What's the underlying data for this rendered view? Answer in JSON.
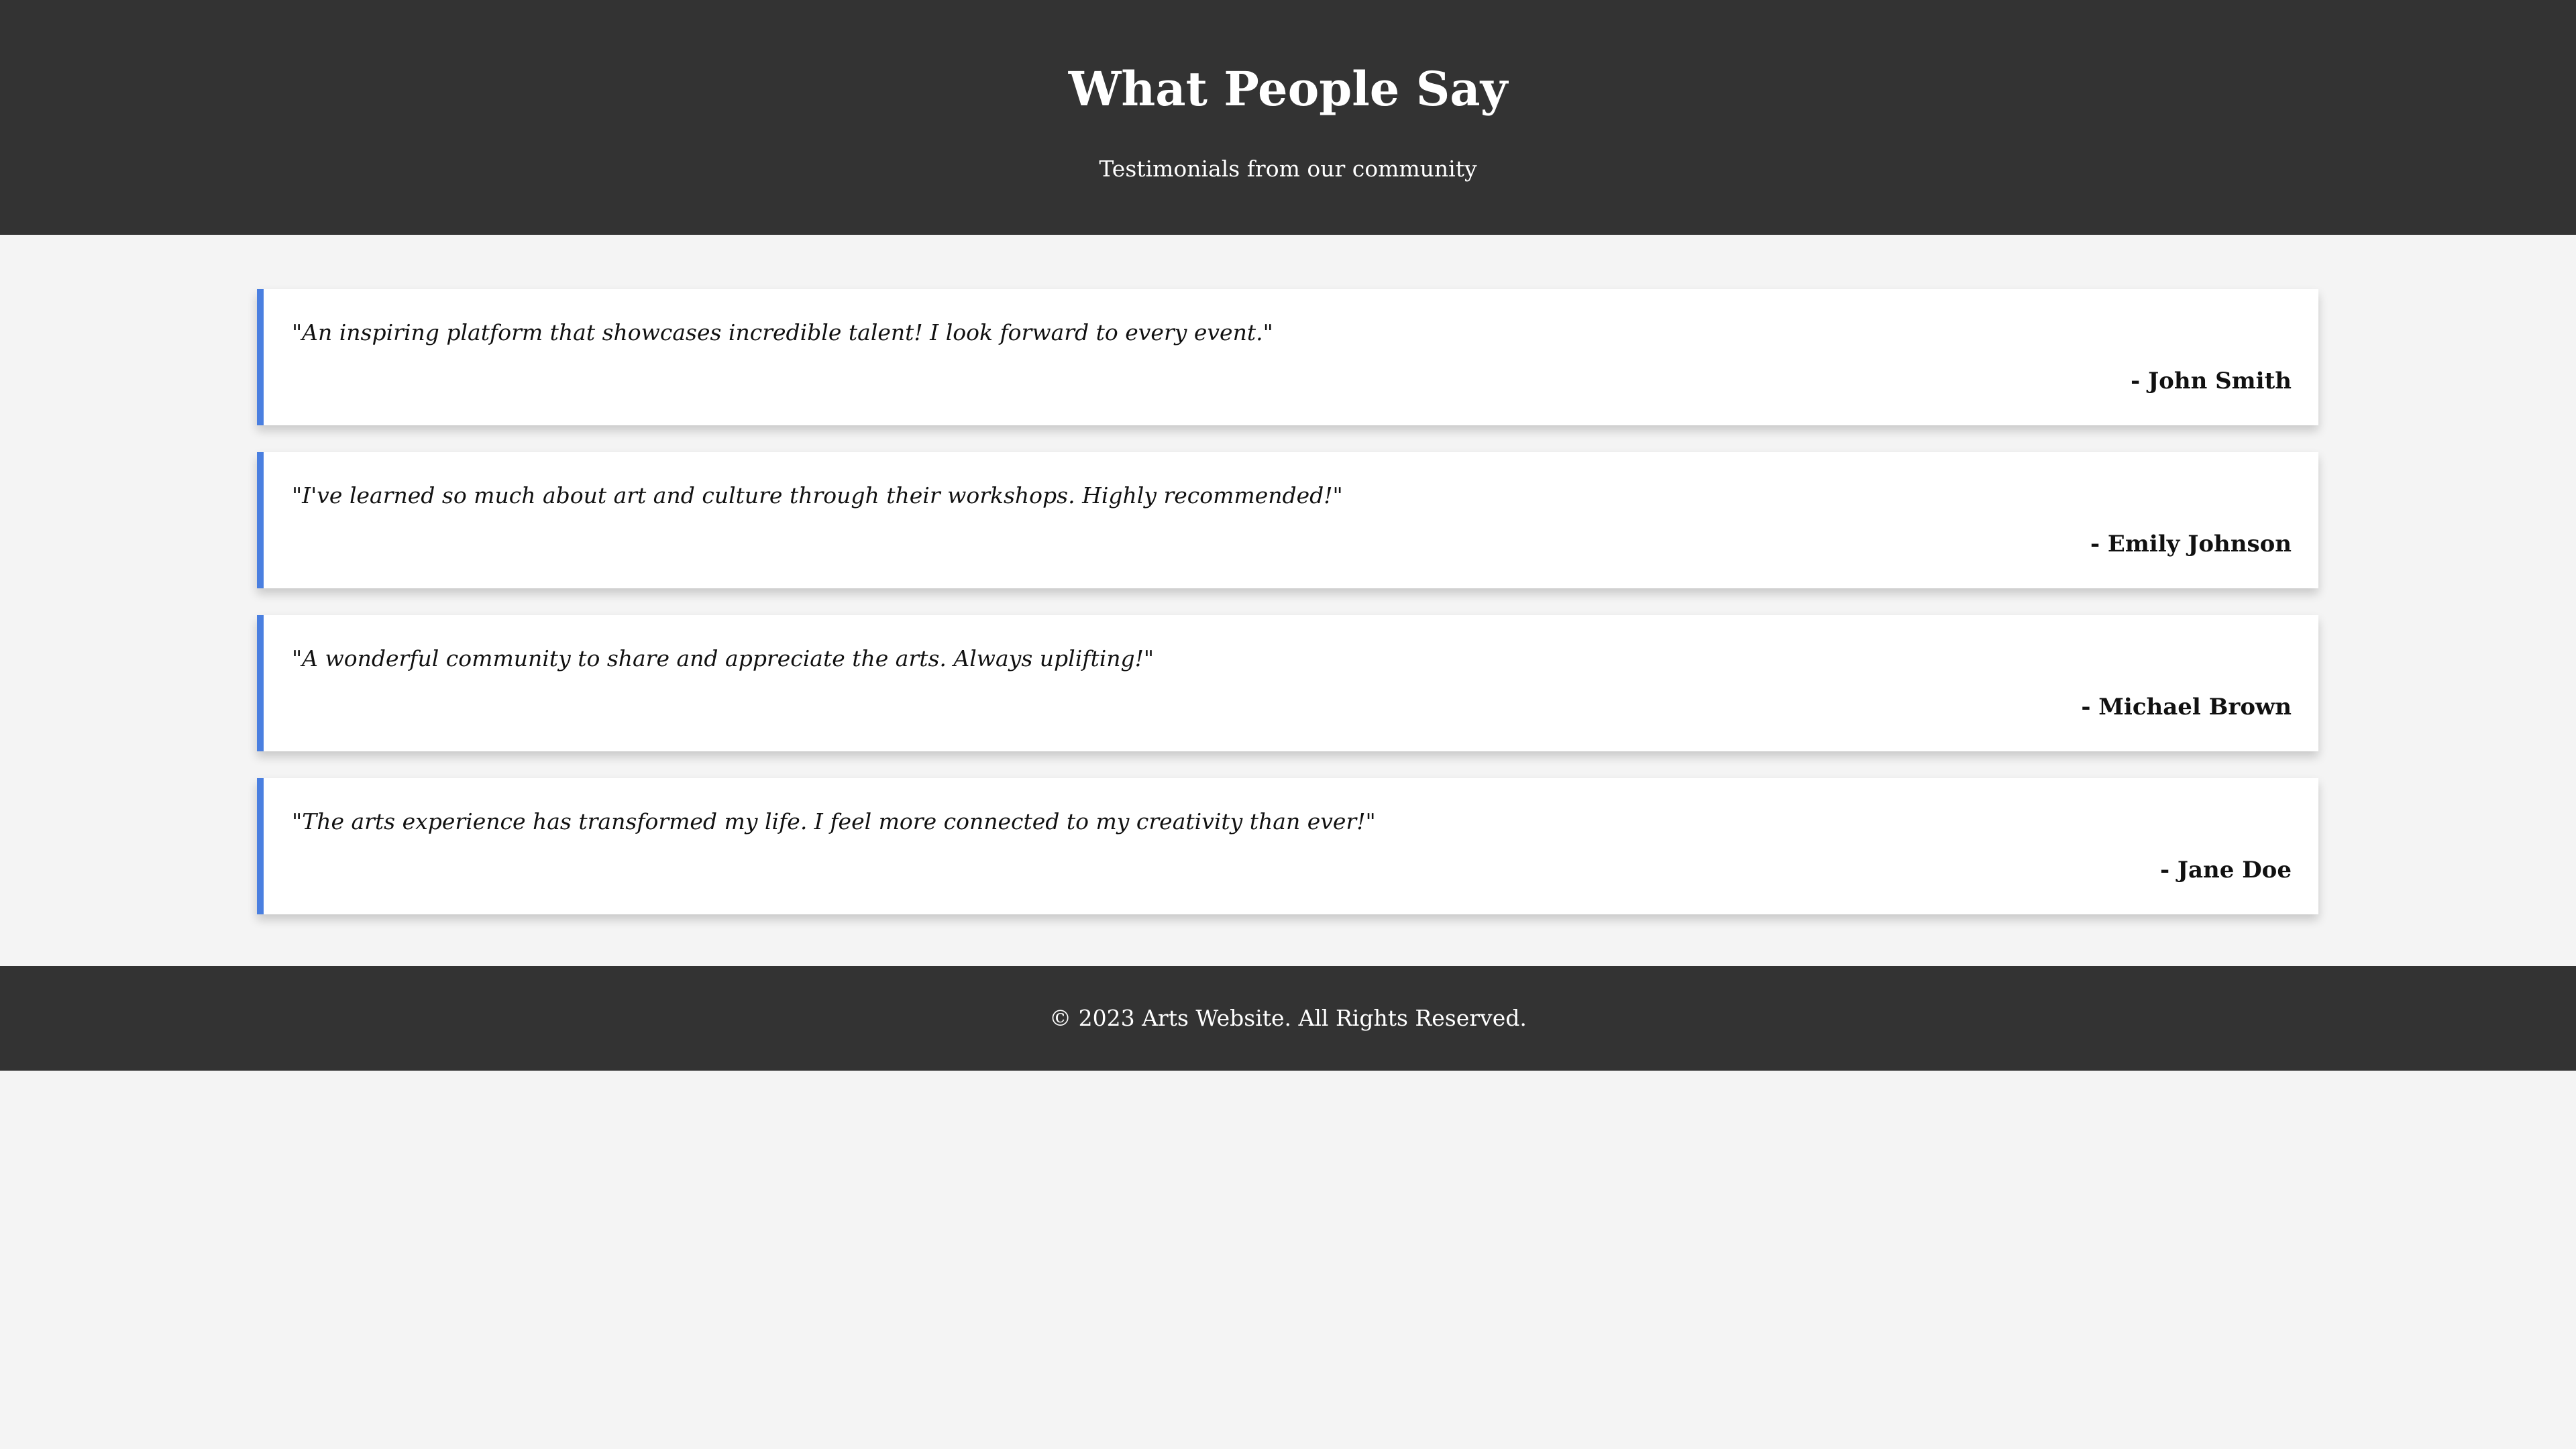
{
  "header": {
    "title": "What People Say",
    "subtitle": "Testimonials from our community"
  },
  "testimonials": [
    {
      "quote": "\"An inspiring platform that showcases incredible talent! I look forward to every event.\"",
      "author": "- John Smith"
    },
    {
      "quote": "\"I've learned so much about art and culture through their workshops. Highly recommended!\"",
      "author": "- Emily Johnson"
    },
    {
      "quote": "\"A wonderful community to share and appreciate the arts. Always uplifting!\"",
      "author": "- Michael Brown"
    },
    {
      "quote": "\"The arts experience has transformed my life. I feel more connected to my creativity than ever!\"",
      "author": "- Jane Doe"
    }
  ],
  "footer": {
    "copyright": "© 2023 Arts Website. All Rights Reserved."
  },
  "colors": {
    "header_bg": "#333333",
    "page_bg": "#f4f4f4",
    "card_bg": "#ffffff",
    "accent": "#4a7fe0"
  }
}
